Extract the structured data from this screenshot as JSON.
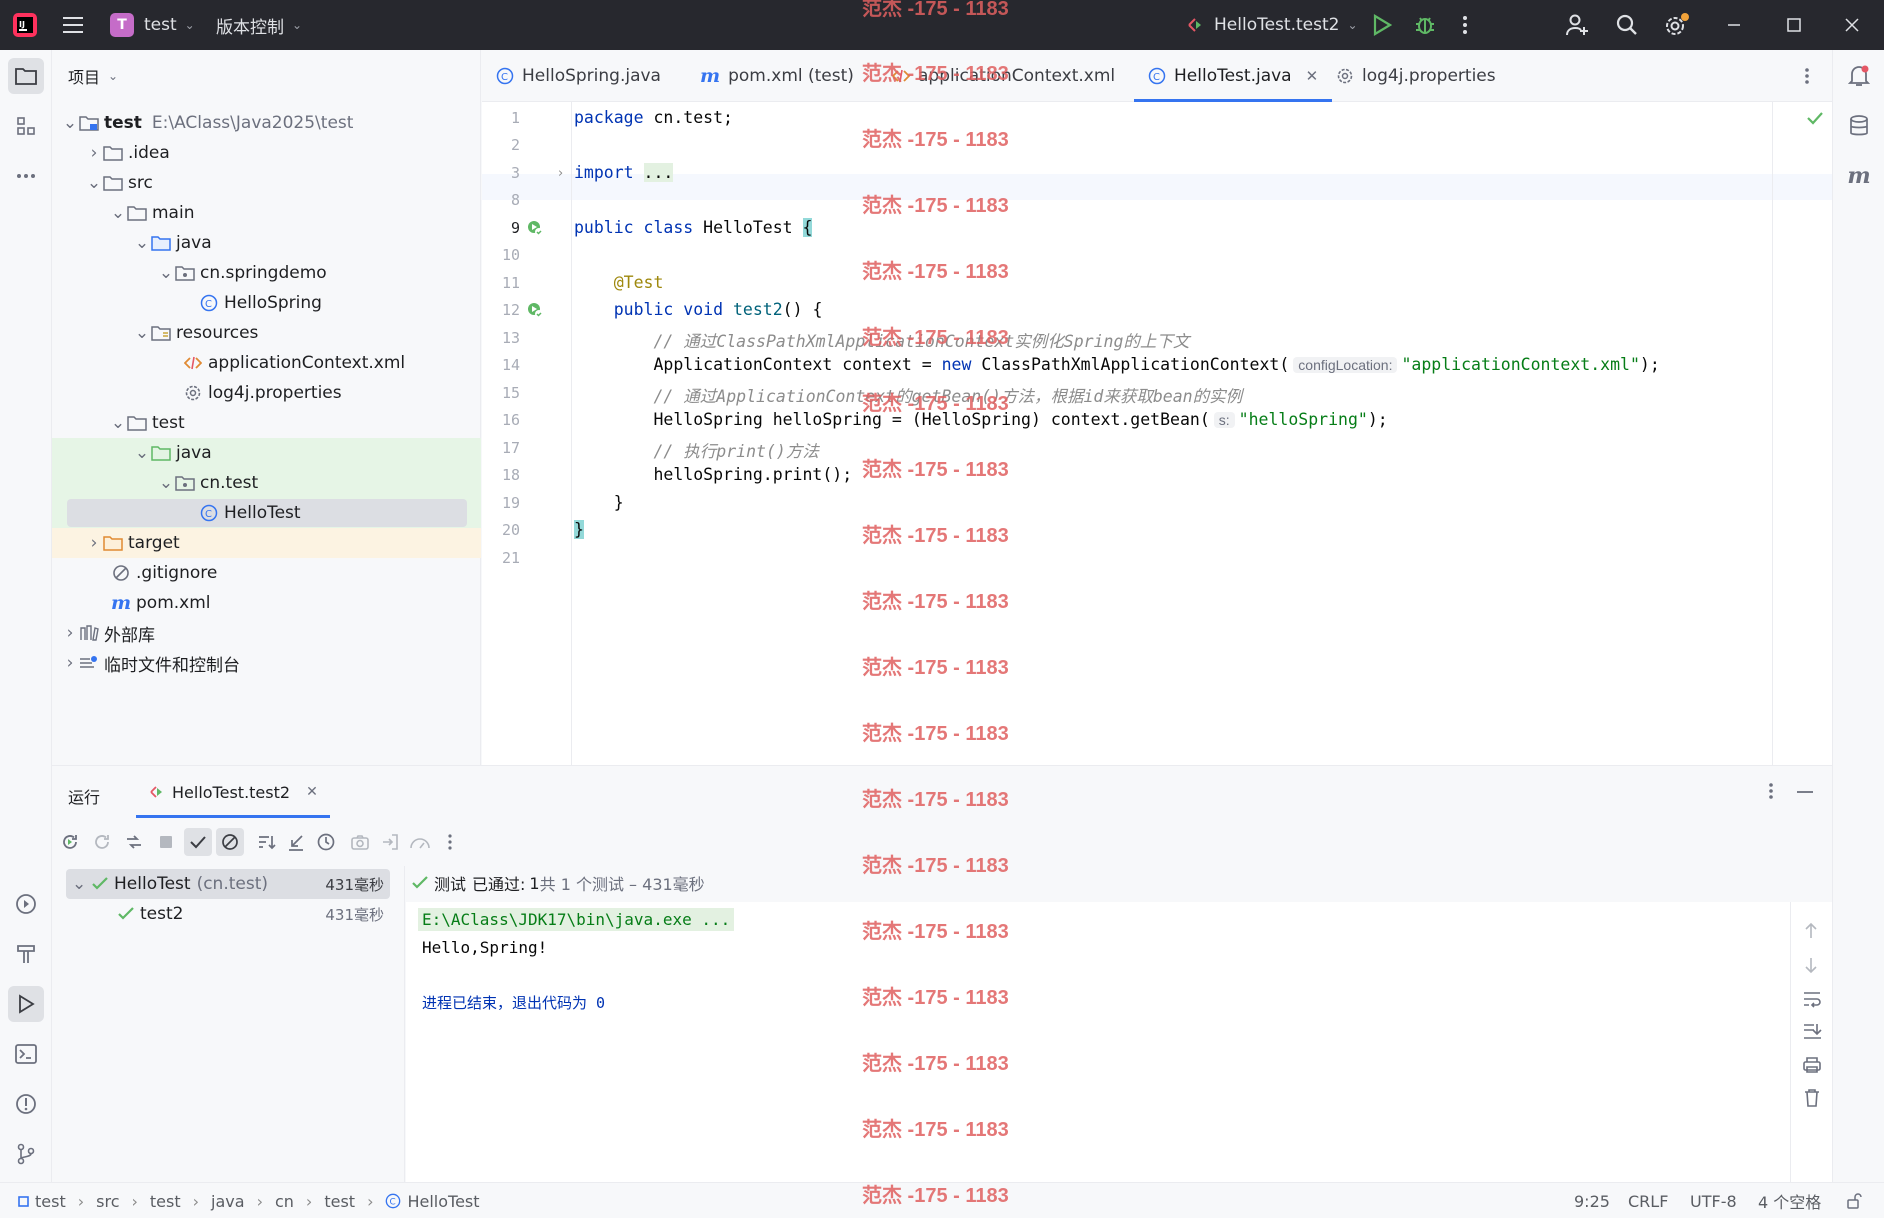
{
  "titlebar": {
    "project_initial": "T",
    "project_name": "test",
    "vcs_label": "版本控制",
    "run_config": "HelloTest.test2"
  },
  "project_panel": {
    "title": "项目",
    "tree": [
      {
        "label": "test",
        "path": "E:\\AClass\\Java2025\\test",
        "icon": "module-folder-icon"
      },
      {
        "label": ".idea",
        "icon": "folder-icon"
      },
      {
        "label": "src",
        "icon": "folder-icon"
      },
      {
        "label": "main",
        "icon": "folder-icon"
      },
      {
        "label": "java",
        "icon": "source-folder-icon"
      },
      {
        "label": "cn.springdemo",
        "icon": "package-icon"
      },
      {
        "label": "HelloSpring",
        "icon": "class-icon"
      },
      {
        "label": "resources",
        "icon": "resources-folder-icon"
      },
      {
        "label": "applicationContext.xml",
        "icon": "xml-file-icon"
      },
      {
        "label": "log4j.properties",
        "icon": "properties-file-icon"
      },
      {
        "label": "test",
        "icon": "folder-icon"
      },
      {
        "label": "java",
        "icon": "test-source-folder-icon"
      },
      {
        "label": "cn.test",
        "icon": "package-icon"
      },
      {
        "label": "HelloTest",
        "icon": "class-icon"
      },
      {
        "label": "target",
        "icon": "excluded-folder-icon"
      },
      {
        "label": ".gitignore",
        "icon": "ignore-file-icon"
      },
      {
        "label": "pom.xml",
        "icon": "maven-icon"
      },
      {
        "label": "外部库",
        "icon": "library-icon"
      },
      {
        "label": "临时文件和控制台",
        "icon": "scratches-icon"
      }
    ]
  },
  "tabs": [
    {
      "label": "HelloSpring.java",
      "icon": "class-icon"
    },
    {
      "label": "pom.xml (test)",
      "icon": "maven-icon"
    },
    {
      "label": "applicationContext.xml",
      "icon": "xml-file-icon"
    },
    {
      "label": "HelloTest.java",
      "icon": "class-icon",
      "active": true
    },
    {
      "label": "log4j.properties",
      "icon": "properties-file-icon"
    }
  ],
  "editor": {
    "line_numbers": [
      "1",
      "2",
      "3",
      "8",
      "9",
      "10",
      "11",
      "12",
      "13",
      "14",
      "15",
      "16",
      "17",
      "18",
      "19",
      "20",
      "21"
    ],
    "code": {
      "l1_kw": "package",
      "l1_rest": " cn.test;",
      "l3_kw": "import",
      "l3_fold": "...",
      "l9_kw": "public class",
      "l9_name": " HelloTest ",
      "l9_brace": "{",
      "l11_ann": "@Test",
      "l12_kw": "public void",
      "l12_fn": " test2",
      "l12_rest": "() {",
      "l13_cmt": "// 通过ClassPathXmlApplicationContext实例化Spring的上下文",
      "l14_a": "ApplicationContext context = ",
      "l14_kw": "new",
      "l14_b": " ClassPathXmlApplicationContext(",
      "l14_hint": "configLocation:",
      "l14_str": "\"applicationContext.xml\"",
      "l14_end": ");",
      "l15_cmt": "// 通过ApplicationContext的getBean()方法，根据id来获取bean的实例",
      "l16_a": "HelloSpring helloSpring = (HelloSpring) context.getBean(",
      "l16_hint": "s:",
      "l16_str": "\"helloSpring\"",
      "l16_end": ");",
      "l17_cmt": "// 执行print()方法",
      "l18": "helloSpring.print();",
      "l19": "}",
      "l20": "}"
    }
  },
  "run_panel": {
    "title": "运行",
    "tab": "HelloTest.test2",
    "tree": [
      {
        "label": "HelloTest",
        "pkg": "(cn.test)",
        "time": "431毫秒"
      },
      {
        "label": "test2",
        "time": "431毫秒"
      }
    ],
    "status_prefix": "测试",
    "status_passed": "已通过:",
    "status_count": "1",
    "status_suffix": "共 1 个测试 – 431毫秒",
    "console": [
      "E:\\AClass\\JDK17\\bin\\java.exe ...",
      "Hello,Spring!",
      "",
      "进程已结束，退出代码为 0"
    ]
  },
  "statusbar": {
    "breadcrumb": [
      "test",
      "src",
      "test",
      "java",
      "cn",
      "test",
      "HelloTest"
    ],
    "position": "9:25",
    "line_sep": "CRLF",
    "encoding": "UTF-8",
    "indent": "4 个空格"
  },
  "watermark": "范杰 -175 - 1183"
}
